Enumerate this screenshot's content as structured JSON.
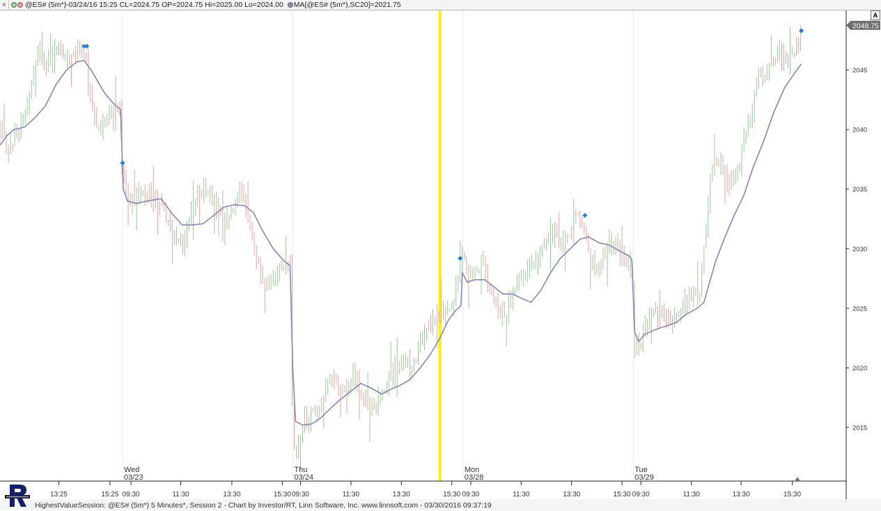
{
  "header": {
    "close_glyph": "×",
    "symbol_text": "@ES# (5m*)-03/24/16 15:25 CL=2024.75 OP=2024.75 Hi=2025.00 Lo=2024.00",
    "ma_text": "MA[@ES# (5m*),SC20]=2021.75",
    "dot_colors": [
      "#9ad29a",
      "#e8a0a0",
      "#8e8ab8"
    ]
  },
  "footer": {
    "text": "HighestValueSession: @ES# (5m*) 5 Minutes*, Session 2 - Chart by Investor/RT, Linn Software, Inc. www.linnsoft.com - 03/30/2016 09:37:19"
  },
  "scale_button": "A",
  "colors": {
    "up_bar": "#9bc89b",
    "down_bar": "#e0a4a4",
    "ma_line": "#8885b4",
    "marker": "#1e7fd6",
    "highlight": "#ffee00",
    "last_price_bg": "#6f6f6f"
  },
  "chart_data": {
    "type": "line",
    "title": "",
    "last_price": "2048.75",
    "ylim": [
      2010.5,
      2050
    ],
    "y_ticks": [
      2015,
      2020,
      2025,
      2030,
      2035,
      2040,
      2045
    ],
    "x_range": [
      0,
      1207
    ],
    "x_ticks": [
      {
        "x": 84,
        "label": "13:25"
      },
      {
        "x": 157,
        "label": "15:25"
      },
      {
        "x": 187,
        "label": "09:30"
      },
      {
        "x": 258,
        "label": "11:30"
      },
      {
        "x": 331,
        "label": "13:30"
      },
      {
        "x": 403,
        "label": "15:30"
      },
      {
        "x": 429,
        "label": "09:30"
      },
      {
        "x": 501,
        "label": "11:30"
      },
      {
        "x": 573,
        "label": "13:30"
      },
      {
        "x": 645,
        "label": "15:30"
      },
      {
        "x": 672,
        "label": "09:30"
      },
      {
        "x": 744,
        "label": "11:30"
      },
      {
        "x": 816,
        "label": "13:30"
      },
      {
        "x": 888,
        "label": "15:30"
      },
      {
        "x": 915,
        "label": "09:30"
      },
      {
        "x": 987,
        "label": "11:30"
      },
      {
        "x": 1058,
        "label": "13:30"
      },
      {
        "x": 1131,
        "label": "15:30"
      }
    ],
    "sessions": [
      {
        "x": 175,
        "day": "Wed",
        "date": "03/23"
      },
      {
        "x": 418,
        "day": "Thu",
        "date": "03/24"
      },
      {
        "x": 661,
        "day": "Mon",
        "date": "03/28"
      },
      {
        "x": 904,
        "day": "Tue",
        "date": "03/29"
      }
    ],
    "highlight_x": 628,
    "price_path": [
      [
        0,
        2040
      ],
      [
        12,
        2038.5
      ],
      [
        22,
        2039.5
      ],
      [
        35,
        2041
      ],
      [
        45,
        2043.5
      ],
      [
        55,
        2046.5
      ],
      [
        65,
        2045.5
      ],
      [
        80,
        2046.5
      ],
      [
        95,
        2046
      ],
      [
        108,
        2046.5
      ],
      [
        117,
        2047
      ],
      [
        122,
        2046
      ],
      [
        130,
        2042
      ],
      [
        140,
        2039.5
      ],
      [
        150,
        2040.5
      ],
      [
        160,
        2041
      ],
      [
        170,
        2042.5
      ],
      [
        174,
        2037
      ],
      [
        178,
        2035
      ],
      [
        185,
        2033.5
      ],
      [
        195,
        2034.5
      ],
      [
        205,
        2035
      ],
      [
        215,
        2034.5
      ],
      [
        225,
        2034
      ],
      [
        235,
        2033
      ],
      [
        245,
        2031
      ],
      [
        255,
        2030
      ],
      [
        265,
        2031
      ],
      [
        275,
        2034
      ],
      [
        290,
        2035
      ],
      [
        305,
        2034
      ],
      [
        320,
        2032.5
      ],
      [
        330,
        2033
      ],
      [
        340,
        2035
      ],
      [
        350,
        2034
      ],
      [
        360,
        2031
      ],
      [
        370,
        2028
      ],
      [
        380,
        2027
      ],
      [
        390,
        2028
      ],
      [
        400,
        2028.5
      ],
      [
        414,
        2029
      ],
      [
        418,
        2013
      ],
      [
        425,
        2014
      ],
      [
        435,
        2015.5
      ],
      [
        445,
        2016
      ],
      [
        455,
        2016.5
      ],
      [
        465,
        2018
      ],
      [
        475,
        2019
      ],
      [
        485,
        2018
      ],
      [
        495,
        2018.5
      ],
      [
        505,
        2019.5
      ],
      [
        515,
        2018
      ],
      [
        525,
        2017
      ],
      [
        535,
        2016.5
      ],
      [
        545,
        2018
      ],
      [
        555,
        2019.5
      ],
      [
        565,
        2020
      ],
      [
        575,
        2020.5
      ],
      [
        585,
        2020
      ],
      [
        595,
        2021
      ],
      [
        605,
        2023
      ],
      [
        615,
        2023.5
      ],
      [
        625,
        2024.5
      ],
      [
        635,
        2025
      ],
      [
        645,
        2025.5
      ],
      [
        652,
        2027
      ],
      [
        658,
        2029
      ],
      [
        662,
        2030
      ],
      [
        668,
        2028
      ],
      [
        678,
        2027.5
      ],
      [
        690,
        2028.5
      ],
      [
        700,
        2027
      ],
      [
        710,
        2025
      ],
      [
        720,
        2024.5
      ],
      [
        730,
        2026
      ],
      [
        740,
        2027.5
      ],
      [
        750,
        2028
      ],
      [
        760,
        2028
      ],
      [
        770,
        2029.5
      ],
      [
        780,
        2031
      ],
      [
        790,
        2031.5
      ],
      [
        800,
        2030.5
      ],
      [
        810,
        2030.5
      ],
      [
        820,
        2032
      ],
      [
        828,
        2033
      ],
      [
        835,
        2031
      ],
      [
        845,
        2029
      ],
      [
        855,
        2028
      ],
      [
        865,
        2030
      ],
      [
        875,
        2030.5
      ],
      [
        885,
        2029.5
      ],
      [
        895,
        2028.5
      ],
      [
        902,
        2028
      ],
      [
        906,
        2022
      ],
      [
        912,
        2021.5
      ],
      [
        920,
        2023
      ],
      [
        930,
        2024.5
      ],
      [
        940,
        2024
      ],
      [
        950,
        2024.5
      ],
      [
        960,
        2024
      ],
      [
        970,
        2024.5
      ],
      [
        980,
        2025.5
      ],
      [
        990,
        2026
      ],
      [
        1000,
        2026.5
      ],
      [
        1005,
        2030
      ],
      [
        1012,
        2035
      ],
      [
        1020,
        2038
      ],
      [
        1030,
        2037
      ],
      [
        1040,
        2035.5
      ],
      [
        1050,
        2036
      ],
      [
        1060,
        2038.5
      ],
      [
        1070,
        2041
      ],
      [
        1080,
        2043.5
      ],
      [
        1090,
        2045
      ],
      [
        1100,
        2045.5
      ],
      [
        1110,
        2046.5
      ],
      [
        1120,
        2046
      ],
      [
        1130,
        2046
      ],
      [
        1140,
        2047.5
      ],
      [
        1144,
        2048.5
      ]
    ],
    "ma_path": [
      [
        0,
        2038.7
      ],
      [
        10,
        2039.5
      ],
      [
        20,
        2040
      ],
      [
        35,
        2040.2
      ],
      [
        50,
        2041
      ],
      [
        65,
        2042
      ],
      [
        80,
        2043.8
      ],
      [
        95,
        2045
      ],
      [
        110,
        2045.7
      ],
      [
        120,
        2045.8
      ],
      [
        130,
        2045
      ],
      [
        140,
        2044
      ],
      [
        150,
        2043
      ],
      [
        165,
        2042
      ],
      [
        172,
        2041.7
      ],
      [
        176,
        2035
      ],
      [
        182,
        2034
      ],
      [
        195,
        2033.8
      ],
      [
        210,
        2034
      ],
      [
        230,
        2034.2
      ],
      [
        245,
        2033
      ],
      [
        260,
        2032
      ],
      [
        275,
        2032
      ],
      [
        290,
        2032.1
      ],
      [
        305,
        2032.8
      ],
      [
        320,
        2033.5
      ],
      [
        335,
        2033.7
      ],
      [
        350,
        2033.6
      ],
      [
        362,
        2033
      ],
      [
        375,
        2031.5
      ],
      [
        390,
        2030
      ],
      [
        405,
        2029
      ],
      [
        414,
        2028.6
      ],
      [
        418,
        2020
      ],
      [
        422,
        2015.5
      ],
      [
        432,
        2015.2
      ],
      [
        445,
        2015.3
      ],
      [
        458,
        2015.8
      ],
      [
        470,
        2016.5
      ],
      [
        485,
        2017.3
      ],
      [
        500,
        2018
      ],
      [
        515,
        2018.7
      ],
      [
        530,
        2018.3
      ],
      [
        545,
        2017.8
      ],
      [
        558,
        2018.2
      ],
      [
        570,
        2018.5
      ],
      [
        585,
        2019
      ],
      [
        600,
        2020
      ],
      [
        615,
        2021.2
      ],
      [
        628,
        2022.5
      ],
      [
        640,
        2024
      ],
      [
        650,
        2024.8
      ],
      [
        658,
        2025.2
      ],
      [
        660,
        2028
      ],
      [
        667,
        2027.2
      ],
      [
        678,
        2027.4
      ],
      [
        692,
        2027.4
      ],
      [
        705,
        2026.8
      ],
      [
        718,
        2026.2
      ],
      [
        732,
        2026.2
      ],
      [
        746,
        2025.8
      ],
      [
        758,
        2025.5
      ],
      [
        772,
        2026.5
      ],
      [
        786,
        2028
      ],
      [
        800,
        2029.2
      ],
      [
        814,
        2030
      ],
      [
        828,
        2030.8
      ],
      [
        840,
        2031
      ],
      [
        855,
        2030.5
      ],
      [
        870,
        2030.3
      ],
      [
        885,
        2029.8
      ],
      [
        898,
        2029.4
      ],
      [
        902,
        2029.1
      ],
      [
        906,
        2023
      ],
      [
        912,
        2022.2
      ],
      [
        920,
        2022.8
      ],
      [
        935,
        2023.2
      ],
      [
        950,
        2023.5
      ],
      [
        965,
        2023.8
      ],
      [
        980,
        2024.5
      ],
      [
        995,
        2025
      ],
      [
        1005,
        2025.5
      ],
      [
        1012,
        2027
      ],
      [
        1022,
        2029
      ],
      [
        1035,
        2031
      ],
      [
        1048,
        2032.8
      ],
      [
        1062,
        2034.5
      ],
      [
        1075,
        2036.8
      ],
      [
        1090,
        2039
      ],
      [
        1105,
        2041.5
      ],
      [
        1120,
        2043.5
      ],
      [
        1135,
        2044.8
      ],
      [
        1144,
        2045.5
      ]
    ],
    "markers": [
      {
        "x": 124,
        "y": 2047
      },
      {
        "x": 175,
        "y": 2037.2
      },
      {
        "x": 657,
        "y": 2029.2
      },
      {
        "x": 835,
        "y": 2032.8
      },
      {
        "x": 1144,
        "y": 2048.3
      }
    ]
  }
}
